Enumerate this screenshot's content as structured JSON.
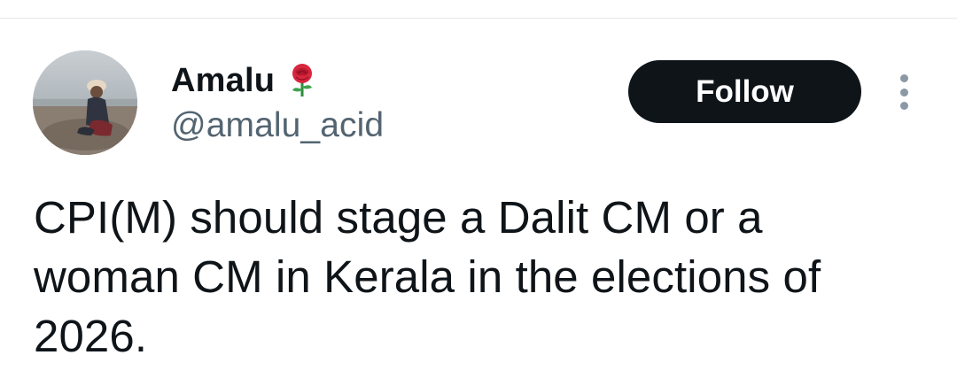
{
  "author": {
    "display_name": "Amalu",
    "badge_emoji": "rose-icon",
    "handle": "@amalu_acid",
    "avatar": "profile-photo-beach"
  },
  "actions": {
    "follow_label": "Follow",
    "more_icon": "more-vertical-icon"
  },
  "tweet": {
    "text": "CPI(M) should stage a Dalit CM or a\nwoman CM in Kerala in the elections of\n2026."
  },
  "colors": {
    "text_primary": "#0f1419",
    "text_secondary": "#536471",
    "follow_bg": "#0f1419",
    "follow_text": "#ffffff"
  }
}
